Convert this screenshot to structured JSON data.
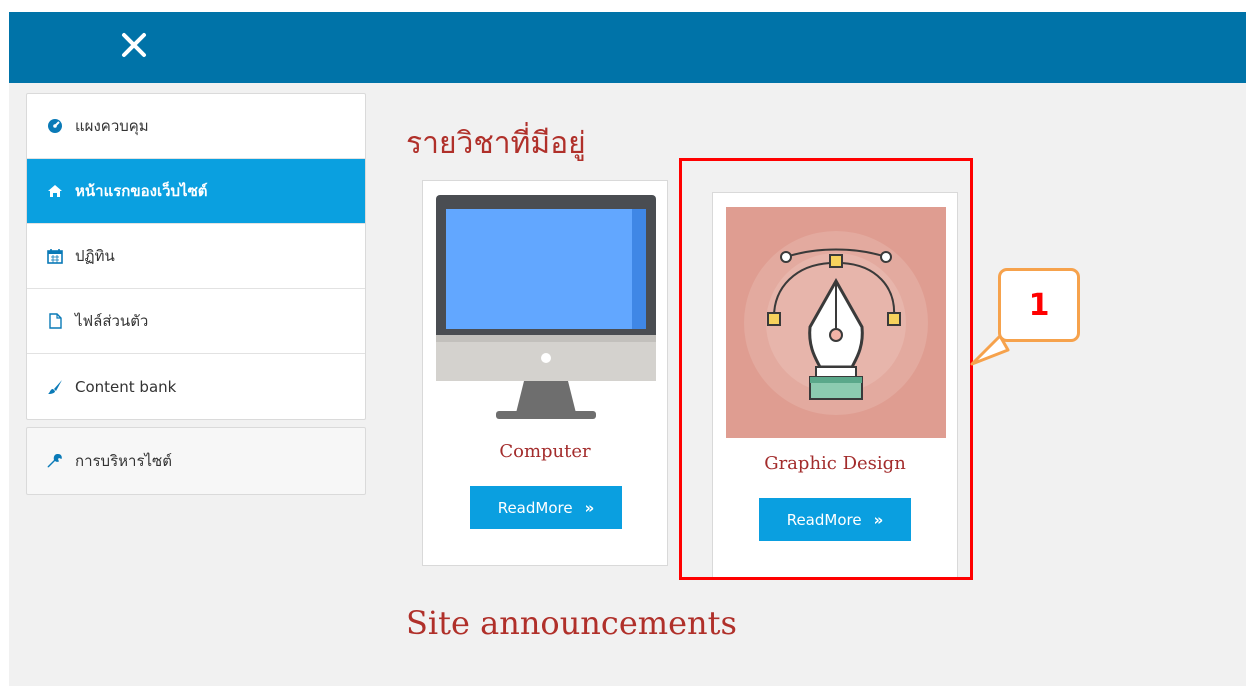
{
  "topbar": {
    "close_icon": "close-icon"
  },
  "sidebar": {
    "items": [
      {
        "label": "แผงควบคุม",
        "icon": "dashboard-icon",
        "active": false
      },
      {
        "label": "หน้าแรกของเว็บไซต์",
        "icon": "home-icon",
        "active": true
      },
      {
        "label": "ปฏิทิน",
        "icon": "calendar-icon",
        "active": false
      },
      {
        "label": "ไฟล์ส่วนตัว",
        "icon": "file-icon",
        "active": false
      },
      {
        "label": "Content bank",
        "icon": "paintbrush-icon",
        "active": false
      }
    ],
    "admin": {
      "label": "การบริหารไซต์",
      "icon": "wrench-icon"
    }
  },
  "main": {
    "courses_heading": "รายวิชาที่มีอยู่",
    "courses": [
      {
        "name": "Computer",
        "button": "ReadMore",
        "button_icon": "double-chevron-right-icon",
        "image": "monitor-illustration"
      },
      {
        "name": "Graphic Design",
        "button": "ReadMore",
        "button_icon": "double-chevron-right-icon",
        "image": "pen-tool-illustration"
      }
    ],
    "announcements_heading": "Site announcements"
  },
  "annotation": {
    "callout_number": "1",
    "highlight_color": "#ff0000",
    "callout_border": "#f6a24c"
  },
  "colors": {
    "topbar": "#0073a8",
    "accent": "#0aa0e0",
    "heading": "#b0302a"
  }
}
